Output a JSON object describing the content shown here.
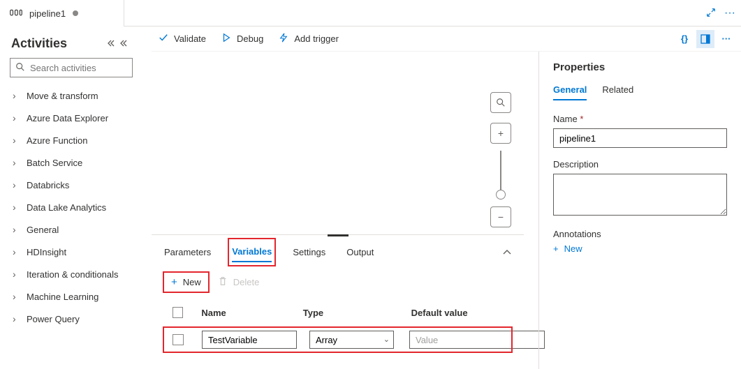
{
  "tab": {
    "title": "pipeline1"
  },
  "activities": {
    "title": "Activities",
    "search_placeholder": "Search activities",
    "items": [
      "Move & transform",
      "Azure Data Explorer",
      "Azure Function",
      "Batch Service",
      "Databricks",
      "Data Lake Analytics",
      "General",
      "HDInsight",
      "Iteration & conditionals",
      "Machine Learning",
      "Power Query"
    ]
  },
  "toolbar": {
    "validate": "Validate",
    "debug": "Debug",
    "add_trigger": "Add trigger"
  },
  "config": {
    "tabs": {
      "parameters": "Parameters",
      "variables": "Variables",
      "settings": "Settings",
      "output": "Output"
    },
    "new_label": "New",
    "delete_label": "Delete",
    "columns": {
      "name": "Name",
      "type": "Type",
      "default": "Default value"
    },
    "row0": {
      "name": "TestVariable",
      "type": "Array",
      "default_placeholder": "Value"
    }
  },
  "properties": {
    "title": "Properties",
    "tabs": {
      "general": "General",
      "related": "Related"
    },
    "name_label": "Name",
    "name_value": "pipeline1",
    "desc_label": "Description",
    "desc_value": "",
    "annotations_label": "Annotations",
    "annotations_new": "New"
  }
}
